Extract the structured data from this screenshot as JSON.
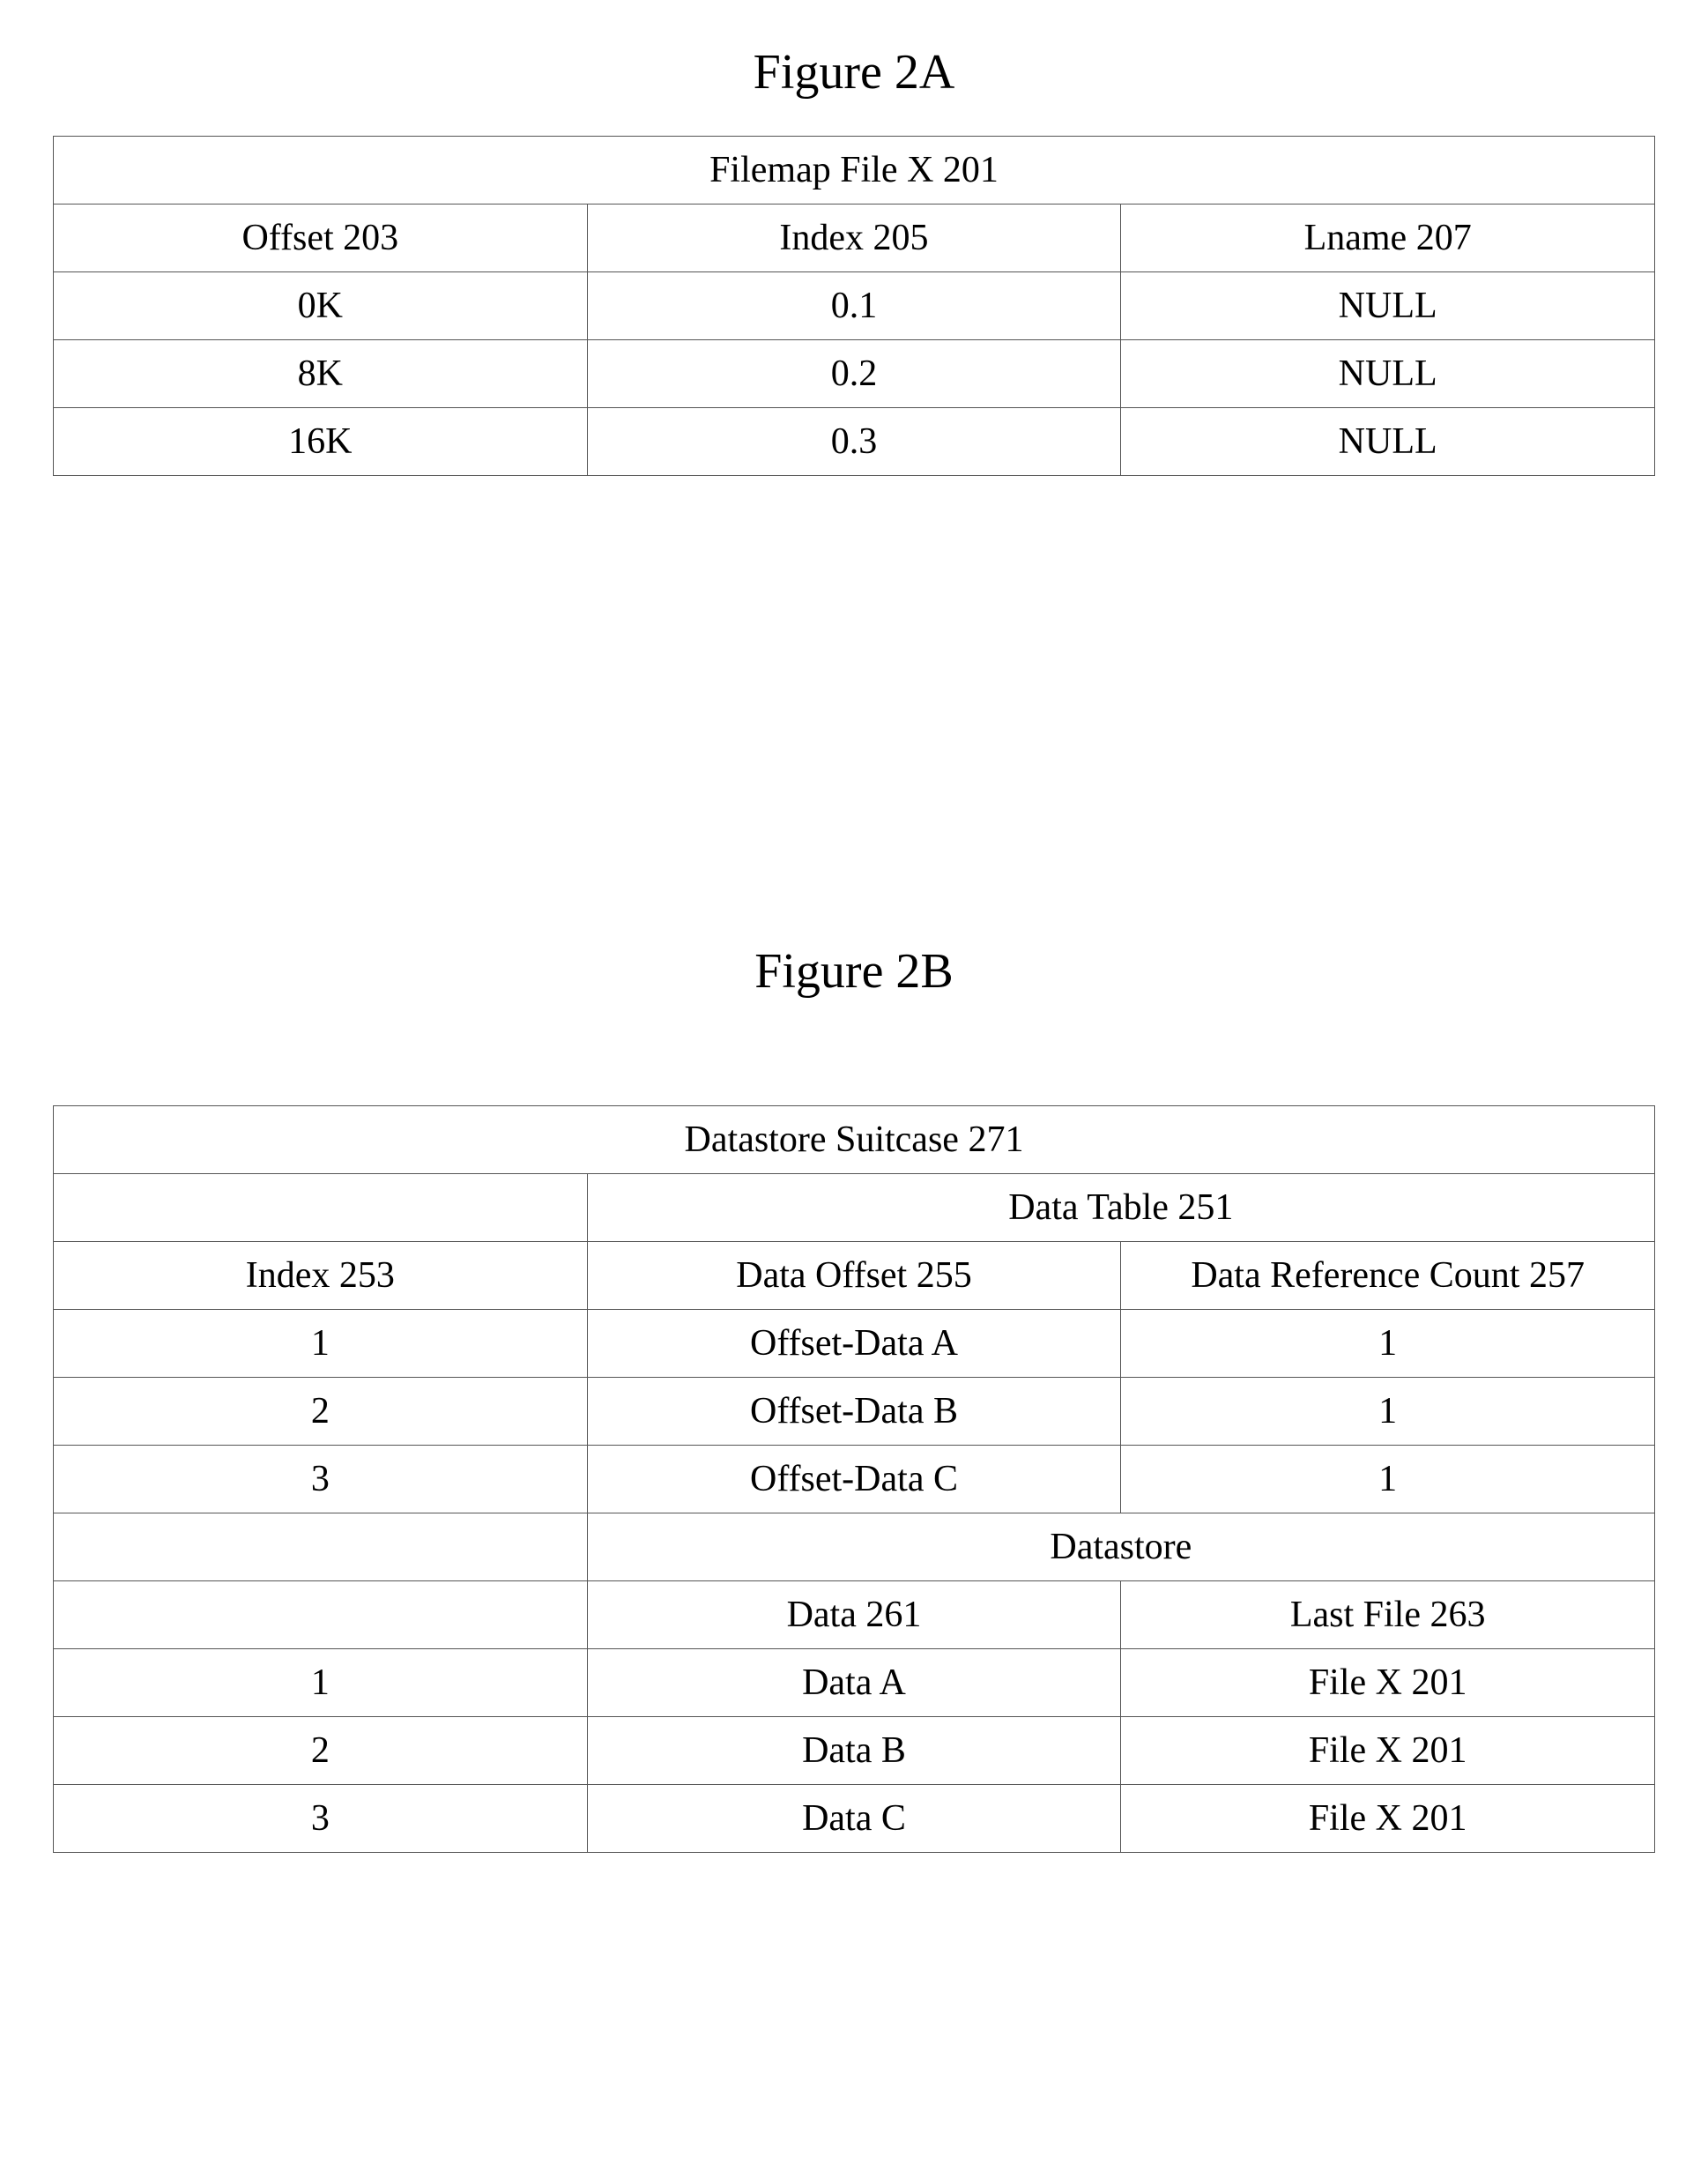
{
  "figA": {
    "title": "Figure 2A",
    "tableTitle": "Filemap File X 201",
    "headers": [
      "Offset 203",
      "Index 205",
      "Lname 207"
    ],
    "rows": [
      [
        "0K",
        "0.1",
        "NULL"
      ],
      [
        "8K",
        "0.2",
        "NULL"
      ],
      [
        "16K",
        "0.3",
        "NULL"
      ]
    ]
  },
  "figB": {
    "title": "Figure 2B",
    "tableTitle": "Datastore Suitcase 271",
    "section1Title": "Data Table 251",
    "section1Headers": [
      "Index 253",
      "Data Offset 255",
      "Data Reference Count 257"
    ],
    "section1Rows": [
      [
        "1",
        "Offset-Data A",
        "1"
      ],
      [
        "2",
        "Offset-Data B",
        "1"
      ],
      [
        "3",
        "Offset-Data C",
        "1"
      ]
    ],
    "section2Title": "Datastore",
    "section2Headers": [
      "",
      "Data 261",
      "Last File 263"
    ],
    "section2Rows": [
      [
        "1",
        "Data A",
        "File X 201"
      ],
      [
        "2",
        "Data B",
        "File X 201"
      ],
      [
        "3",
        "Data C",
        "File X 201"
      ]
    ]
  }
}
